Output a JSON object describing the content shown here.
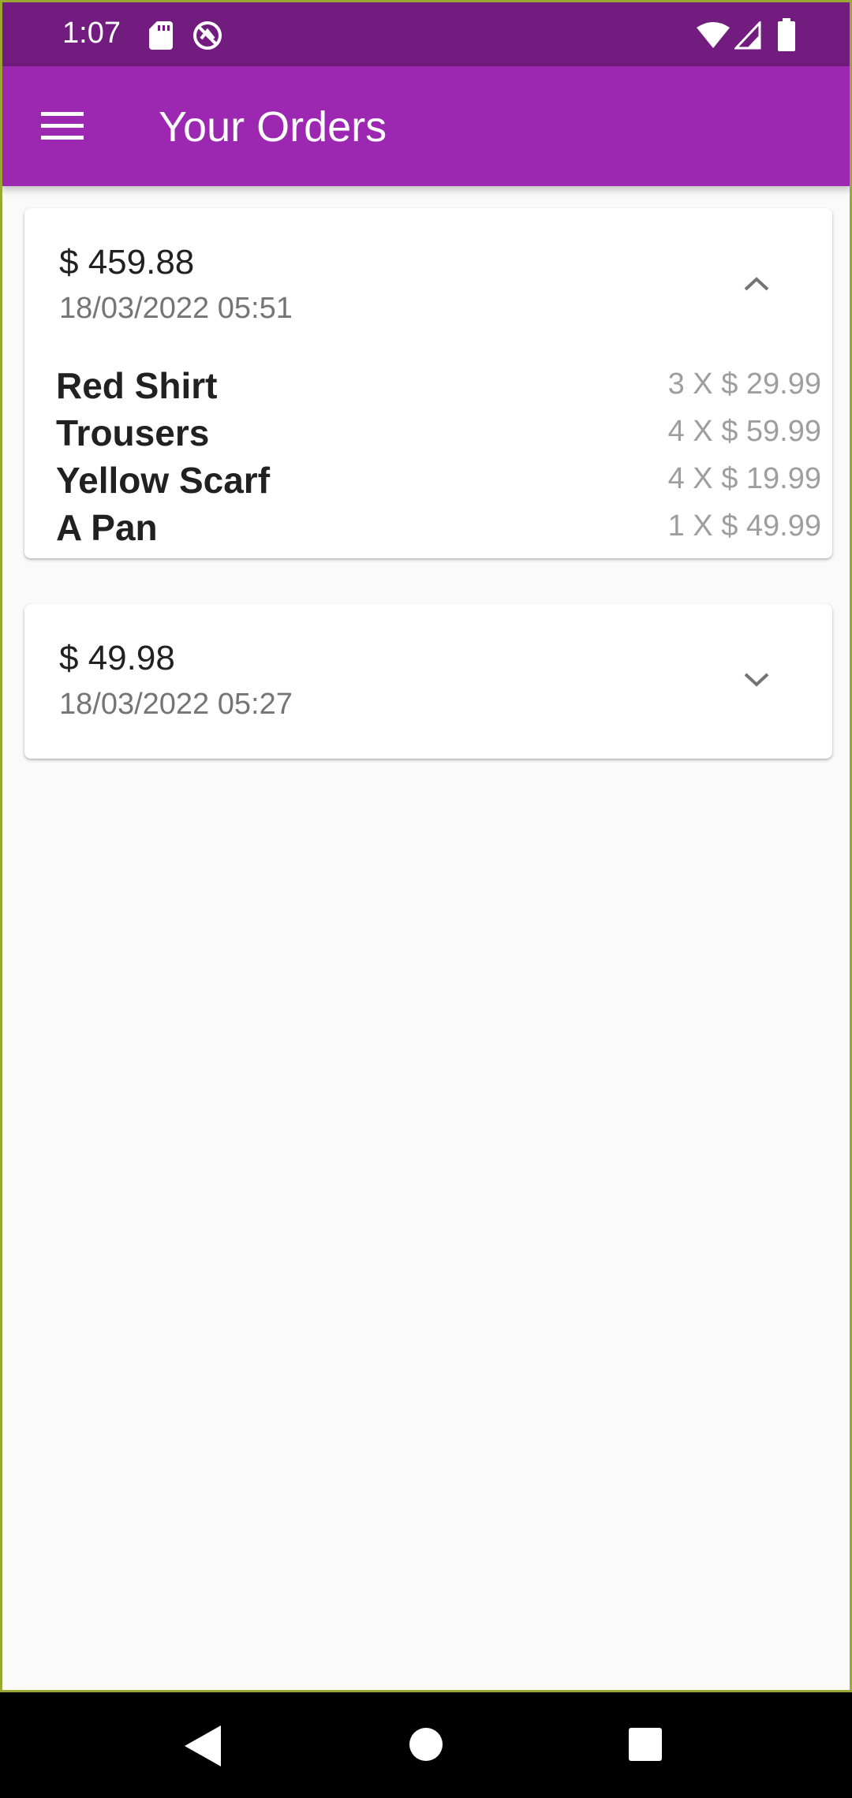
{
  "status_bar": {
    "time": "1:07",
    "icons": [
      "sd-card-icon",
      "sync-icon",
      "wifi-icon",
      "signal-icon",
      "battery-icon"
    ]
  },
  "app_bar": {
    "title": "Your Orders",
    "menu_icon": "hamburger-menu-icon",
    "background": "#9c27b0"
  },
  "orders": [
    {
      "amount": "$ 459.88",
      "date": "18/03/2022 05:51",
      "expanded": true,
      "toggle_icon": "chevron-up-icon",
      "items": [
        {
          "name": "Red Shirt",
          "qty": "3 X $ 29.99"
        },
        {
          "name": "Trousers",
          "qty": "4 X $ 59.99"
        },
        {
          "name": "Yellow Scarf",
          "qty": "4 X $ 19.99"
        },
        {
          "name": "A Pan",
          "qty": "1 X $ 49.99"
        }
      ]
    },
    {
      "amount": "$ 49.98",
      "date": "18/03/2022 05:27",
      "expanded": false,
      "toggle_icon": "chevron-down-icon",
      "items": []
    }
  ],
  "nav_bar": {
    "icons": [
      "back-icon",
      "home-icon",
      "recents-icon"
    ]
  }
}
